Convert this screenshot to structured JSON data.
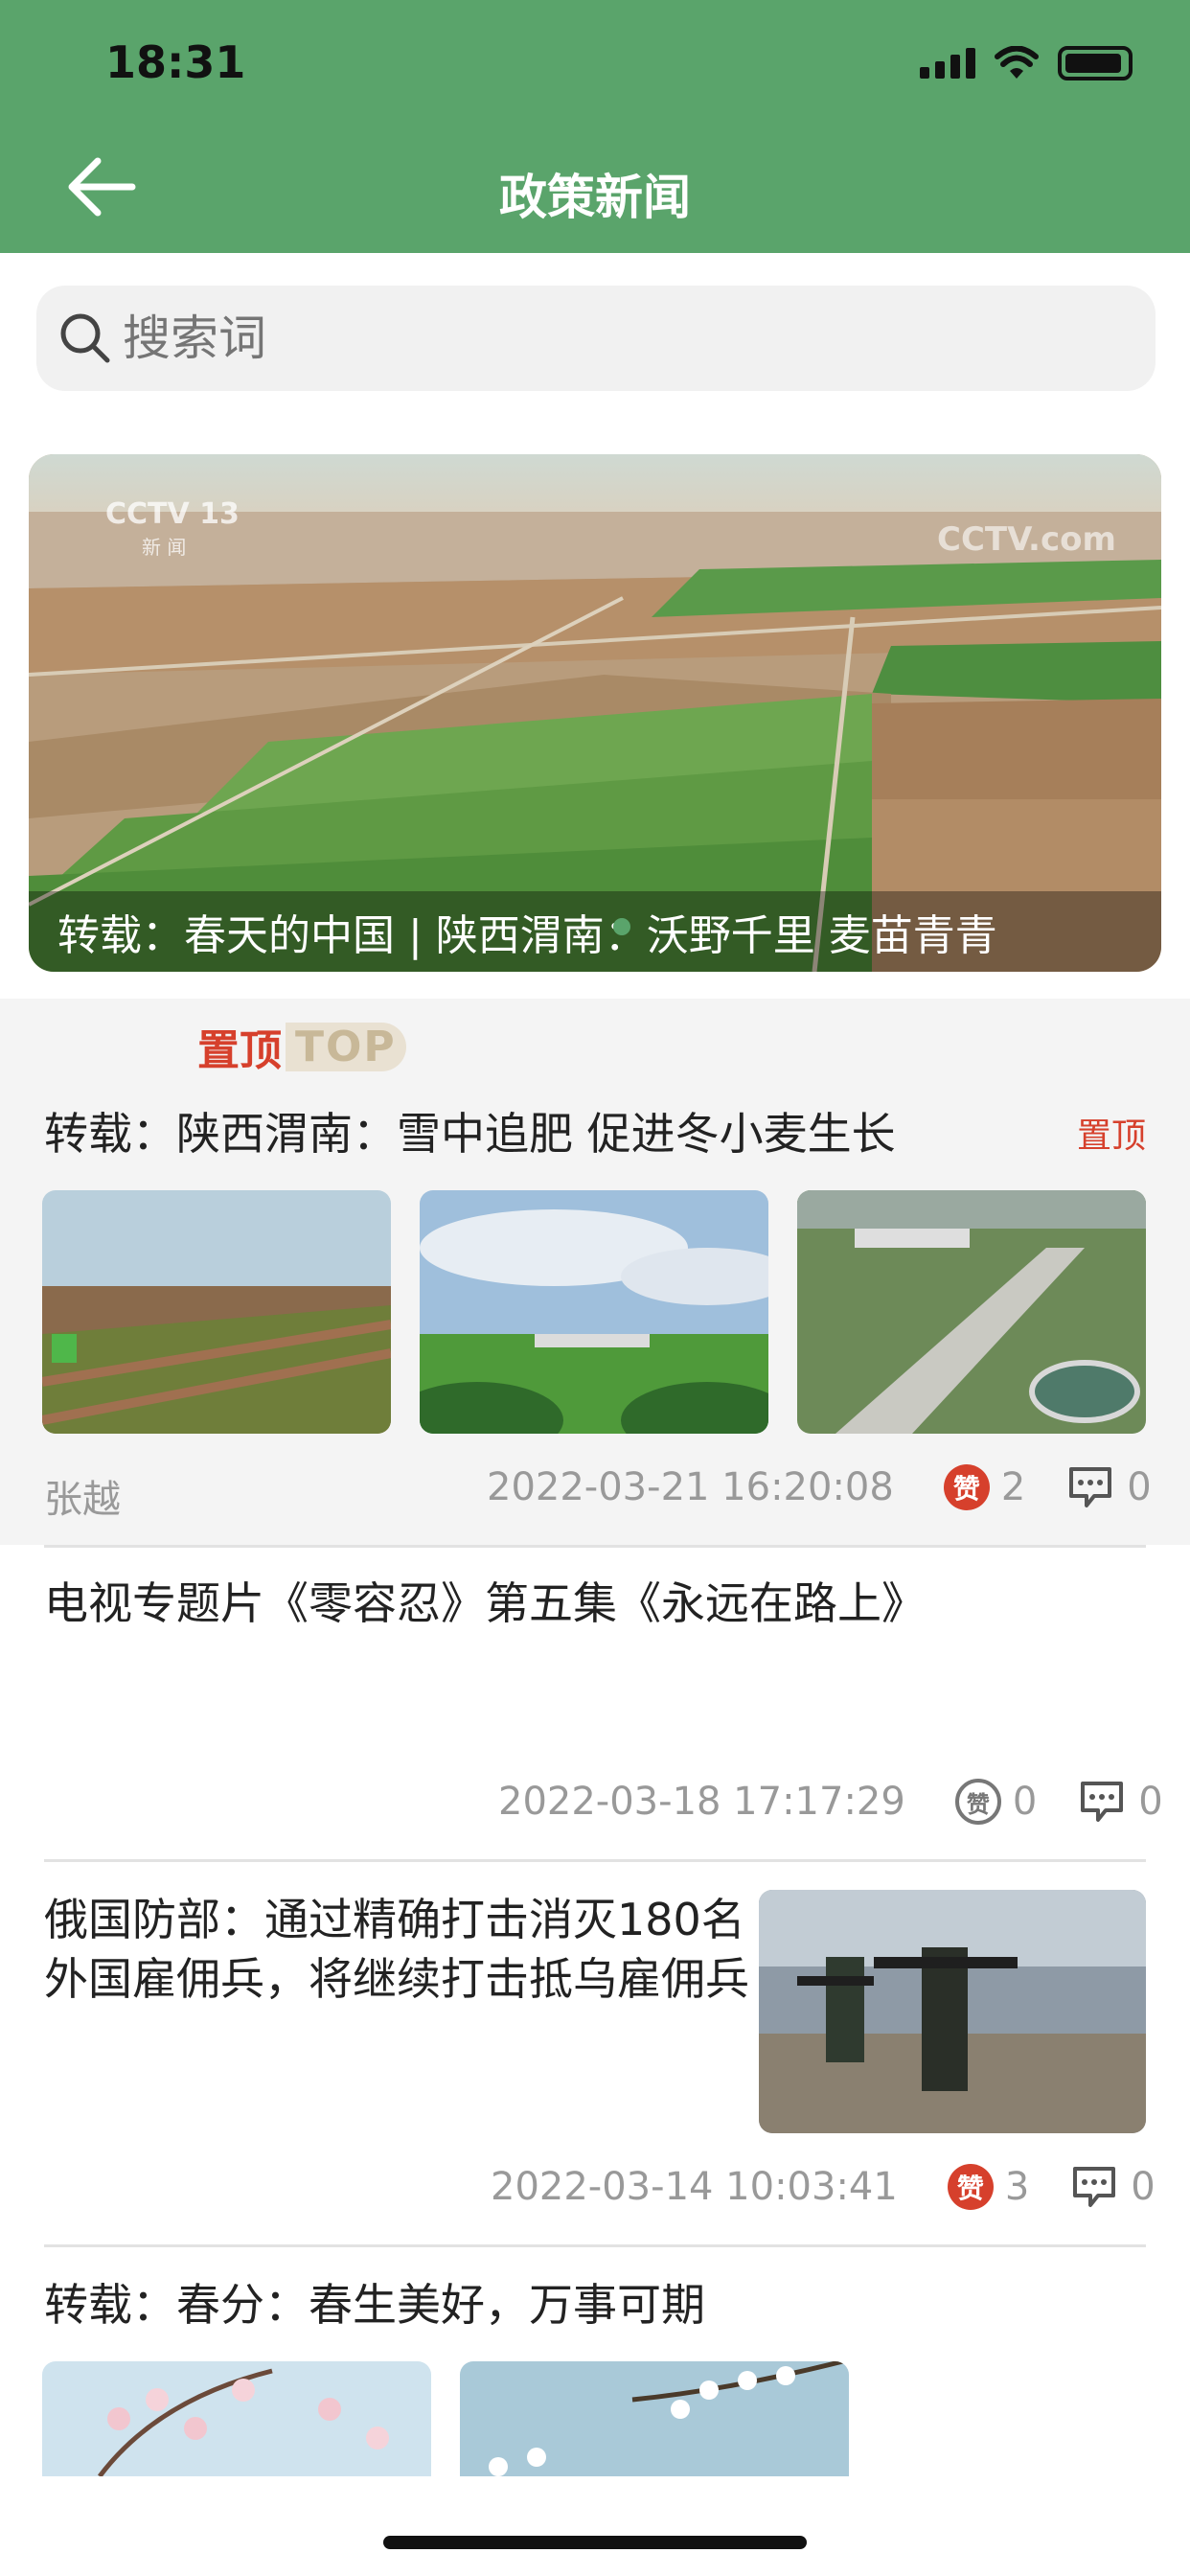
{
  "status_bar": {
    "time": "18:31"
  },
  "header": {
    "title": "政策新闻",
    "back_icon": "arrow-left-icon"
  },
  "search": {
    "placeholder": "搜索词",
    "icon": "search-icon"
  },
  "banner": {
    "caption": "转载：春天的中国 | 陕西渭南：沃野千里 麦苗青青",
    "watermark_left": "CCTV 13",
    "watermark_left_sub": "新 闻",
    "watermark_right": "CCTV.com"
  },
  "pinned_logo": {
    "cn": "置顶",
    "en": "TOP"
  },
  "articles": [
    {
      "title": "转载：陕西渭南：雪中追肥 促进冬小麦生长",
      "tag": "置顶",
      "author": "张越",
      "datetime": "2022-03-21 16:20:08",
      "likes": "2",
      "comments": "0",
      "like_label": "赞"
    },
    {
      "title": "电视专题片《零容忍》第五集《永远在路上》",
      "datetime": "2022-03-18 17:17:29",
      "likes": "0",
      "comments": "0",
      "like_label": "赞"
    },
    {
      "title": "俄国防部：通过精确打击消灭180名外国雇佣兵，将继续打击抵乌雇佣兵",
      "datetime": "2022-03-14 10:03:41",
      "likes": "3",
      "comments": "0",
      "like_label": "赞"
    },
    {
      "title": "转载：春分：春生美好，万事可期"
    }
  ],
  "colors": {
    "header_green": "#5aa46b",
    "accent_red": "#d6402c",
    "meta_gray": "#999999"
  }
}
